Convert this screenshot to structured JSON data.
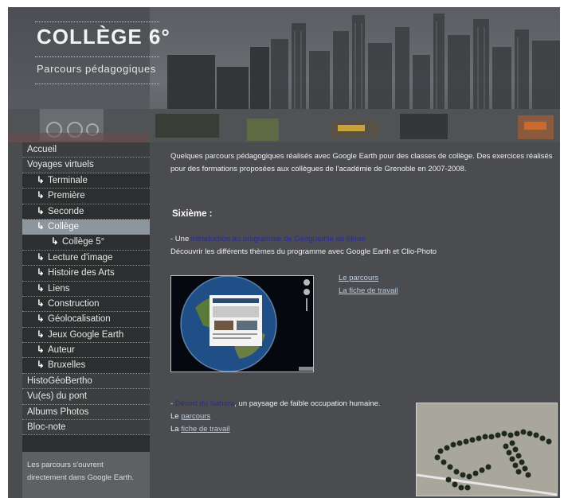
{
  "site": {
    "title": "COLLÈGE 6°",
    "subtitle": "Parcours pédagogiques"
  },
  "nav": [
    {
      "label": "Accueil",
      "level": 0
    },
    {
      "label": "Voyages virtuels",
      "level": 0
    },
    {
      "label": "Terminale",
      "level": 1
    },
    {
      "label": "Première",
      "level": 1
    },
    {
      "label": "Seconde",
      "level": 1
    },
    {
      "label": "Collège",
      "level": 1,
      "active": true
    },
    {
      "label": "Collège 5°",
      "level": 2
    },
    {
      "label": "Lecture d'image",
      "level": 1
    },
    {
      "label": "Histoire des Arts",
      "level": 1
    },
    {
      "label": "Liens",
      "level": 1
    },
    {
      "label": "Construction",
      "level": 1
    },
    {
      "label": "Géolocalisation",
      "level": 1
    },
    {
      "label": "Jeux Google Earth",
      "level": 1
    },
    {
      "label": "Auteur",
      "level": 1
    },
    {
      "label": "Bruxelles",
      "level": 1
    },
    {
      "label": "HistoGéoBertho",
      "level": 0
    },
    {
      "label": "Vu(es) du pont",
      "level": 0
    },
    {
      "label": "Albums Photos",
      "level": 0
    },
    {
      "label": "Bloc-note",
      "level": 0
    }
  ],
  "sidebar_note": "Les parcours s'ouvrent directement dans Google Earth.",
  "content": {
    "intro": "Quelques parcours pédagogiques réalisés avec Google Earth pour des classes de collège. Des exercices réalisés pour des formations proposées aux collègues de l'académie de Grenoble en 2007-2008.",
    "section_heading": "Sixième :",
    "item1": {
      "prefix": "- Une ",
      "link": "introduction au programme de Géographie de 6ème",
      "description": "Découvrir les différents thèmes du programme avec Google Earth et Clio-Photo",
      "link_parcours": "Le parcours",
      "link_fiche": "La fiche de travail"
    },
    "item2": {
      "prefix": "- ",
      "link": "Désert du Sahara",
      "text": ", un paysage de faible occupation humaine.",
      "line2_prefix": "Le ",
      "line2_link": "parcours",
      "line3_prefix": "La ",
      "line3_link": "fiche de travail"
    }
  },
  "colors": {
    "background": "#4b4c4f",
    "sidebar": "#2c2e2f",
    "active_nav": "#8c969c",
    "highlight_link": "#2a2a96",
    "underline_link": "#b9cde0"
  },
  "icons": {
    "nav_arrow": "↳"
  }
}
